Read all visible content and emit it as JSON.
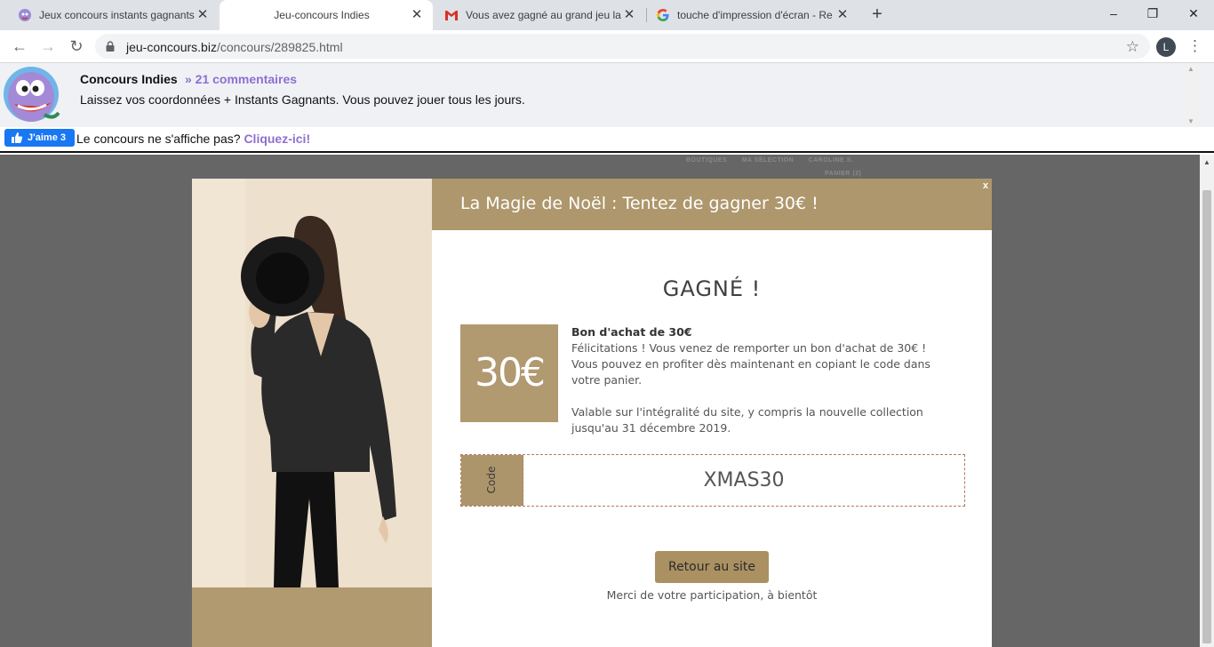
{
  "browser": {
    "tabs": [
      {
        "title": "Jeux concours instants gagnants",
        "favicon": "genie-icon"
      },
      {
        "title": "Jeu-concours Indies",
        "favicon": "none",
        "active": true
      },
      {
        "title": "Vous avez gagné au grand jeu la",
        "favicon": "gmail-icon"
      },
      {
        "title": "touche d'impression d'écran - Re",
        "favicon": "google-icon"
      }
    ],
    "new_tab": "+",
    "window_controls": {
      "minimize": "–",
      "restore": "❐",
      "close": "✕"
    },
    "url_host": "jeu-concours.biz",
    "url_path": "/concours/289825.html",
    "profile_initial": "L",
    "menu": "⋮"
  },
  "header": {
    "site_name": "Concours Indies",
    "comments": "» 21 commentaires",
    "description": "Laissez vos coordonnées + Instants Gagnants. Vous pouvez jouer tous les jours.",
    "like_label": "J'aime 3",
    "notice": "Le concours ne s'affiche pas? ",
    "notice_link": "Cliquez-ici!"
  },
  "background_site": {
    "nav": [
      "BOUTIQUES",
      "MA SÉLECTION",
      "CAROLINE S."
    ],
    "cart": "PANIER (2)"
  },
  "modal": {
    "title": "La Magie de Noël : Tentez de gagner 30€ !",
    "close": "x",
    "result": "GAGNÉ !",
    "amount": "30€",
    "voucher_title": "Bon d'achat de 30€",
    "voucher_line1": "Félicitations ! Vous venez de remporter un bon d'achat de 30€ ! Vous pouvez en profiter dès maintenant en copiant le code dans votre panier.",
    "voucher_line2": "Valable sur l'intégralité du site, y compris la nouvelle collection jusqu'au 31 décembre 2019.",
    "code_label": "Code",
    "code_value": "XMAS30",
    "back_button": "Retour au site",
    "thanks": "Merci de votre participation, à bientôt"
  },
  "colors": {
    "accent_gold": "#ae976c",
    "link_purple": "#8e6fd0",
    "facebook_blue": "#1877f2",
    "overlay_gray": "#666666"
  }
}
